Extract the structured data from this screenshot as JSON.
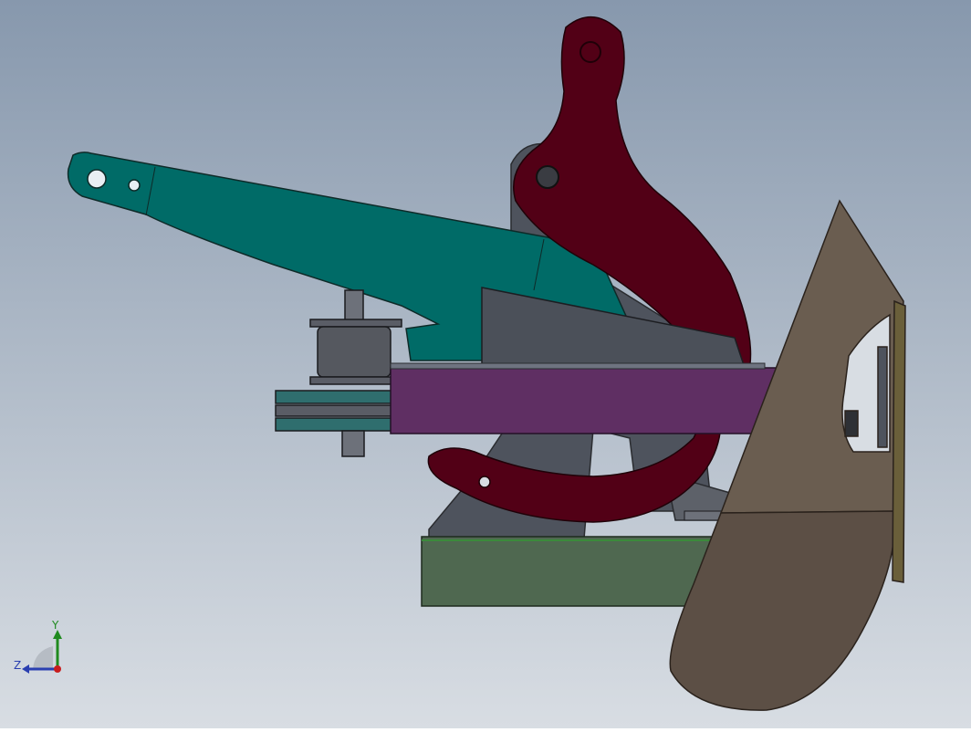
{
  "scene": {
    "background_top": "#8798ad",
    "background_bottom": "#d8dde3",
    "parts": {
      "arm": "#006b67",
      "cam_lever": "#520016",
      "frame": "#4e535d",
      "crossbar": "#5f2f63",
      "base_plate": "#4f6850",
      "blade": "#6a5d50",
      "blade_lower": "#5c4f45",
      "pulley": "#5a5d66",
      "belt": "#2f6e6e"
    }
  },
  "triad": {
    "y_label": "Y",
    "z_label": "Z",
    "y_color": "#1f8a1f",
    "z_color": "#2a3fb0",
    "x_color": "#c81d1d"
  }
}
